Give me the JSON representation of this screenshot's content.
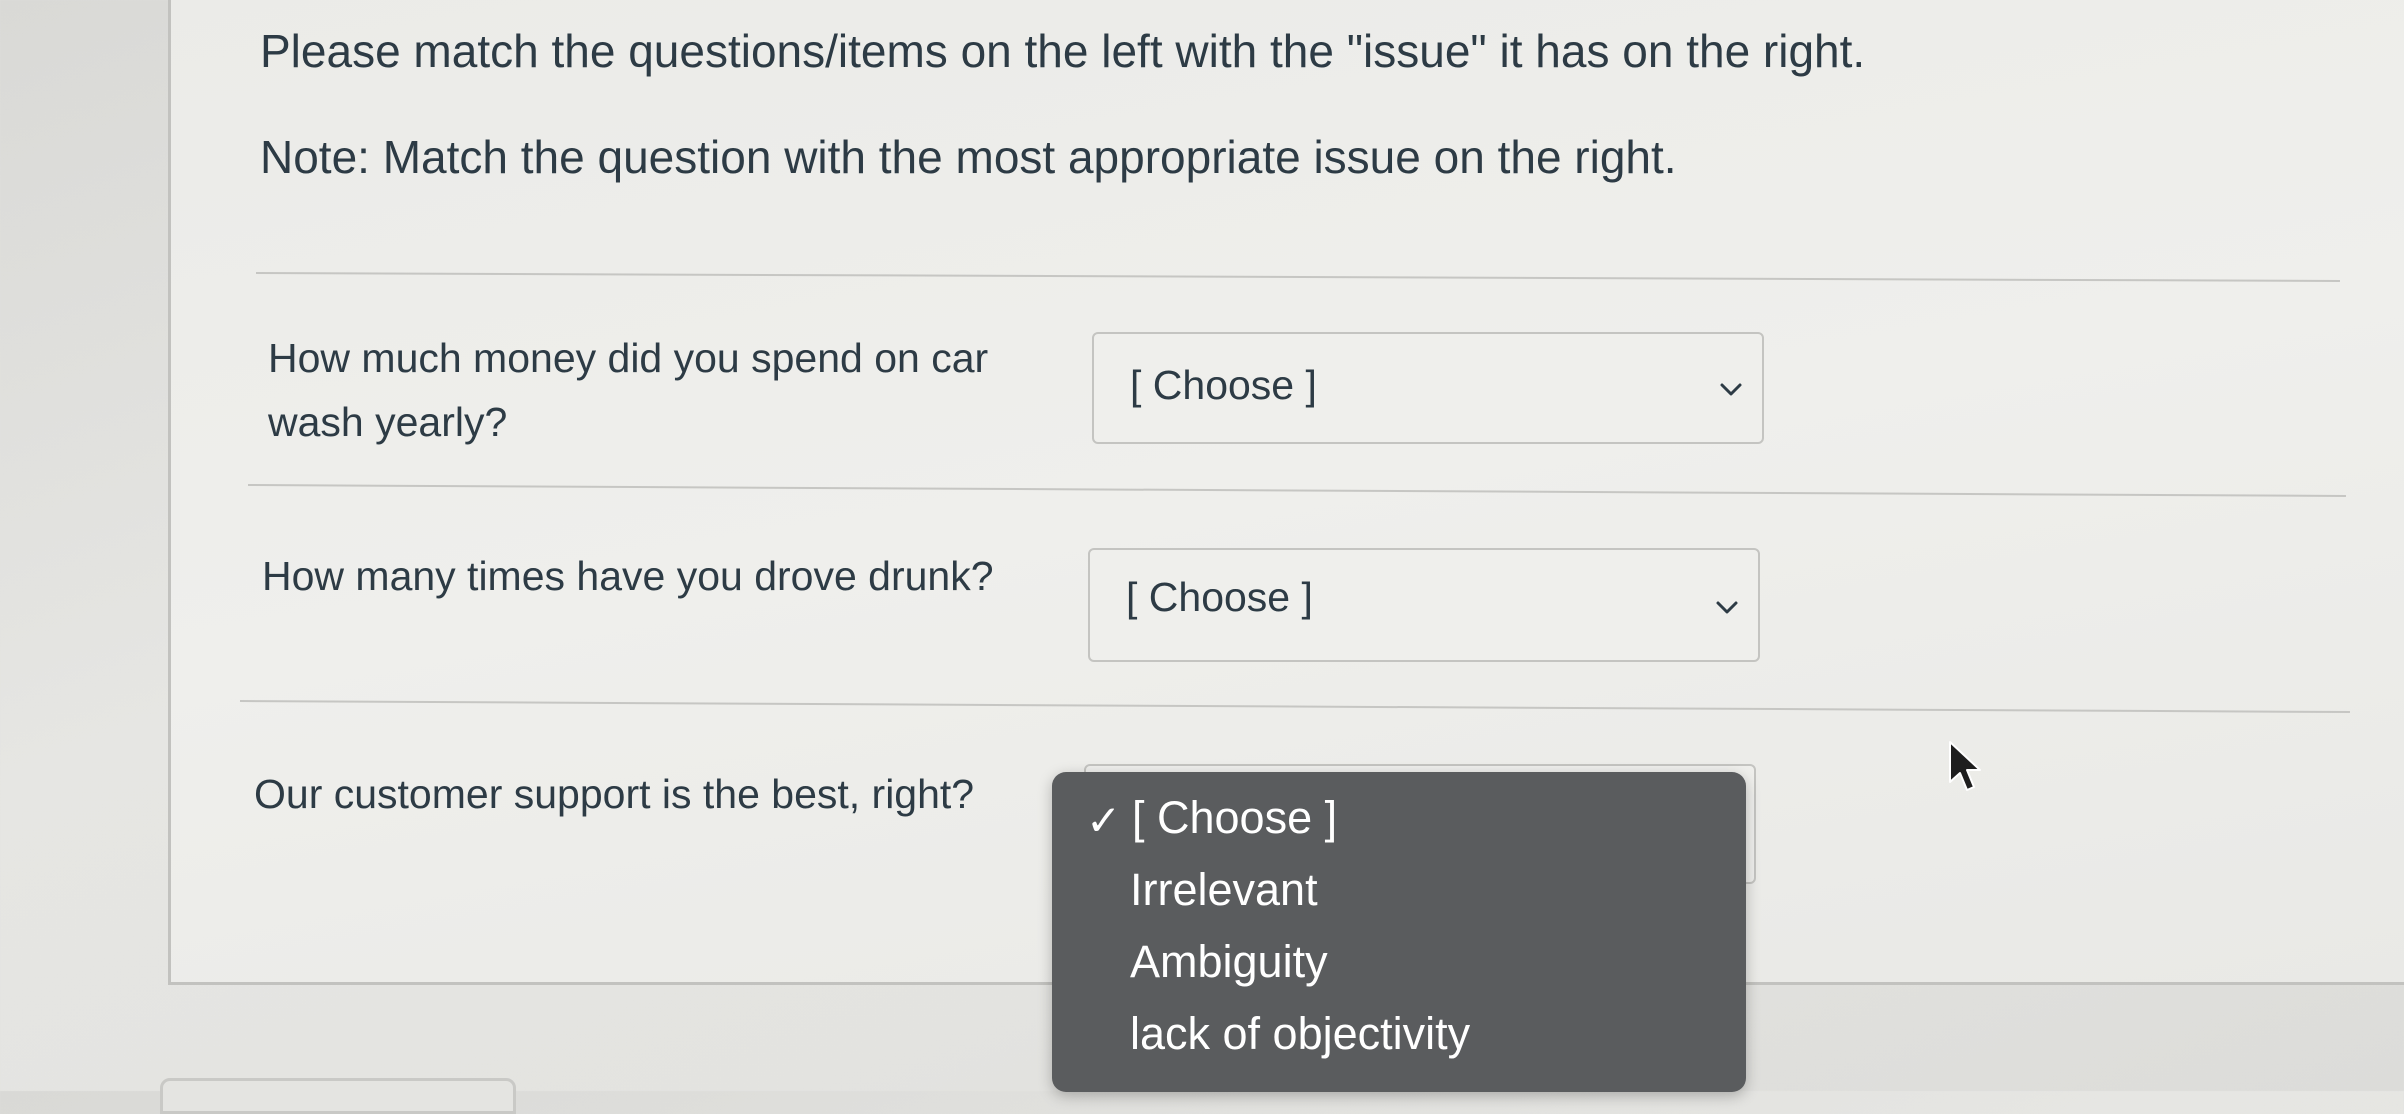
{
  "quiz": {
    "prompt": "Please match the questions/items on the left with the \"issue\" it has on the right.",
    "note": "Note: Match the question with the most appropriate issue on the right.",
    "questions": [
      {
        "text_line1": "How much money did you spend on car",
        "text_line2": "wash yearly?",
        "selected": "[ Choose ]"
      },
      {
        "text": "How many times have you drove drunk?",
        "selected": "[ Choose ]"
      },
      {
        "text": "Our customer support is the best, right?",
        "selected": "[ Choose ]"
      }
    ],
    "dropdown": {
      "checkmark": "✓",
      "options": [
        "[ Choose ]",
        "Irrelevant",
        "Ambiguity",
        "lack of objectivity"
      ]
    }
  },
  "icons": {
    "chevron": "chevron-down-icon",
    "cursor": "mouse-pointer-icon",
    "check": "checkmark-icon"
  }
}
